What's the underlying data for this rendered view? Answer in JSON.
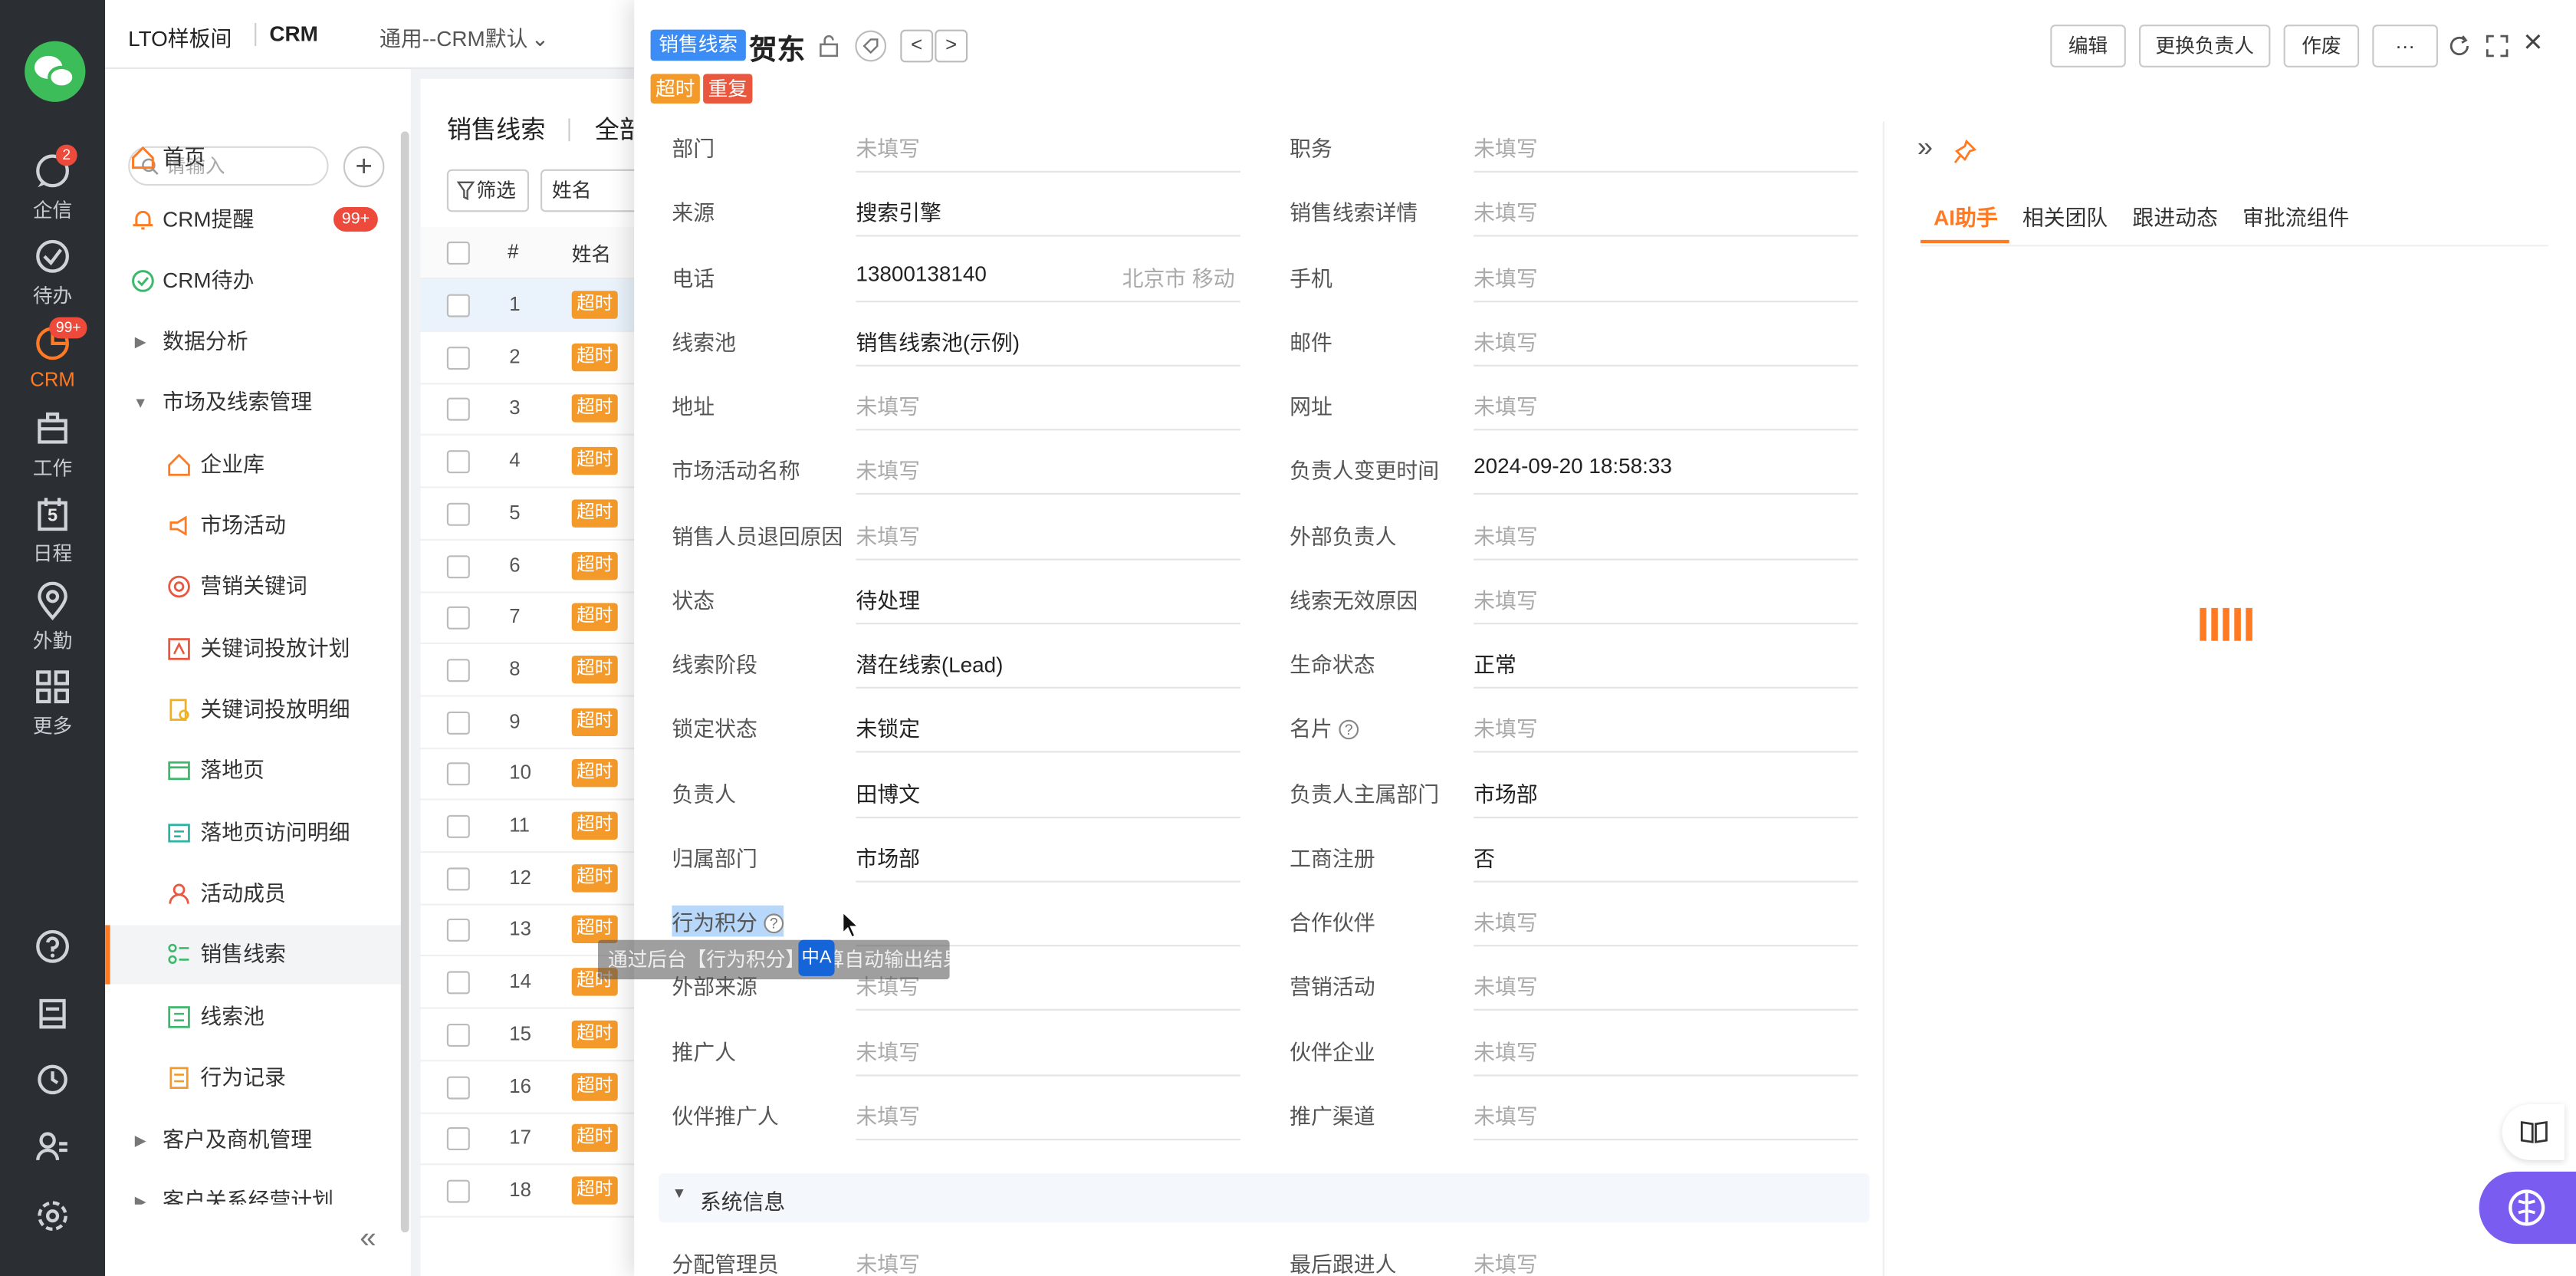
{
  "topbar": {
    "company": "LTO样板间",
    "app": "CRM",
    "view": "通用--CRM默认"
  },
  "rail": {
    "items": [
      {
        "label": "企信",
        "badge": "2"
      },
      {
        "label": "待办"
      },
      {
        "label": "CRM",
        "badge": "99+"
      },
      {
        "label": "工作"
      },
      {
        "label": "日程",
        "day": "5"
      },
      {
        "label": "外勤"
      },
      {
        "label": "更多"
      }
    ]
  },
  "menu": {
    "search_placeholder": "请输入",
    "plus": "+",
    "collapse": "«",
    "items": [
      {
        "label": "首页"
      },
      {
        "label": "CRM提醒",
        "badge": "99+"
      },
      {
        "label": "CRM待办"
      },
      {
        "label": "数据分析"
      },
      {
        "label": "市场及线索管理"
      },
      {
        "label": "企业库"
      },
      {
        "label": "市场活动"
      },
      {
        "label": "营销关键词"
      },
      {
        "label": "关键词投放计划"
      },
      {
        "label": "关键词投放明细"
      },
      {
        "label": "落地页"
      },
      {
        "label": "落地页访问明细"
      },
      {
        "label": "活动成员"
      },
      {
        "label": "销售线索"
      },
      {
        "label": "线索池"
      },
      {
        "label": "行为记录"
      },
      {
        "label": "客户及商机管理"
      },
      {
        "label": "客户关系经营计划"
      }
    ]
  },
  "list": {
    "title": "销售线索",
    "scope": "全部",
    "filter": "筛选",
    "field": "姓名",
    "col_index": "#",
    "col_name": "姓名",
    "tag_overtime": "超时",
    "rows": [
      "1",
      "2",
      "3",
      "4",
      "5",
      "6",
      "7",
      "8",
      "9",
      "10",
      "11",
      "12",
      "13",
      "14",
      "15",
      "16",
      "17",
      "18"
    ]
  },
  "detail": {
    "badge": "销售线索",
    "title": "贺东",
    "nav_prev": "<",
    "nav_next": ">",
    "tags": [
      "超时",
      "重复"
    ],
    "buttons": {
      "edit": "编辑",
      "change_owner": "更换负责人",
      "void": "作废",
      "more": "···"
    },
    "close": "×",
    "fields": [
      {
        "label": "部门",
        "value": "未填写",
        "empty": true
      },
      {
        "label": "职务",
        "value": "未填写",
        "empty": true
      },
      {
        "label": "来源",
        "value": "搜索引擎"
      },
      {
        "label": "销售线索详情",
        "value": "未填写",
        "empty": true
      },
      {
        "label": "电话",
        "value": "13800138140",
        "extra": "北京市 移动"
      },
      {
        "label": "手机",
        "value": "未填写",
        "empty": true
      },
      {
        "label": "线索池",
        "value": "销售线索池(示例)"
      },
      {
        "label": "邮件",
        "value": "未填写",
        "empty": true
      },
      {
        "label": "地址",
        "value": "未填写",
        "empty": true
      },
      {
        "label": "网址",
        "value": "未填写",
        "empty": true
      },
      {
        "label": "市场活动名称",
        "value": "未填写",
        "empty": true
      },
      {
        "label": "负责人变更时间",
        "value": "2024-09-20 18:58:33"
      },
      {
        "label": "销售人员退回原因",
        "value": "未填写",
        "empty": true
      },
      {
        "label": "外部负责人",
        "value": "未填写",
        "empty": true
      },
      {
        "label": "状态",
        "value": "待处理"
      },
      {
        "label": "线索无效原因",
        "value": "未填写",
        "empty": true
      },
      {
        "label": "线索阶段",
        "value": "潜在线索(Lead)"
      },
      {
        "label": "生命状态",
        "value": "正常"
      },
      {
        "label": "锁定状态",
        "value": "未锁定"
      },
      {
        "label": "名片",
        "value": "未填写",
        "empty": true,
        "help": true
      },
      {
        "label": "负责人",
        "value": "田博文"
      },
      {
        "label": "负责人主属部门",
        "value": "市场部"
      },
      {
        "label": "归属部门",
        "value": "市场部"
      },
      {
        "label": "工商注册",
        "value": "否"
      },
      {
        "label": "行为积分",
        "value": "",
        "help": true,
        "highlight": true
      },
      {
        "label": "合作伙伴",
        "value": "未填写",
        "empty": true
      },
      {
        "label": "外部来源",
        "value": "未填写",
        "empty": true
      },
      {
        "label": "营销活动",
        "value": "未填写",
        "empty": true
      },
      {
        "label": "推广人",
        "value": "未填写",
        "empty": true
      },
      {
        "label": "伙伴企业",
        "value": "未填写",
        "empty": true
      },
      {
        "label": "伙伴推广人",
        "value": "未填写",
        "empty": true
      },
      {
        "label": "推广渠道",
        "value": "未填写",
        "empty": true
      }
    ],
    "section_title": "系统信息",
    "bottom_fields": [
      {
        "label": "分配管理员",
        "value": "未填写"
      },
      {
        "label": "最后跟进人",
        "value": "未填写"
      }
    ],
    "tooltip": "通过后台【行为积分】计算自动输出结果",
    "translate_badge": "中A",
    "ai_tabs": [
      "AI助手",
      "相关团队",
      "跟进动态",
      "审批流组件"
    ],
    "expand": "»"
  },
  "colors": {
    "accent": "#ff7a22",
    "badge_red": "#ee4a3b",
    "tag_orange": "#f39a2b",
    "tag_red": "#e8573e",
    "tag_blue": "#3c8cf5",
    "rail_bg": "#2b2f33",
    "fab": "#7b5cf0"
  }
}
